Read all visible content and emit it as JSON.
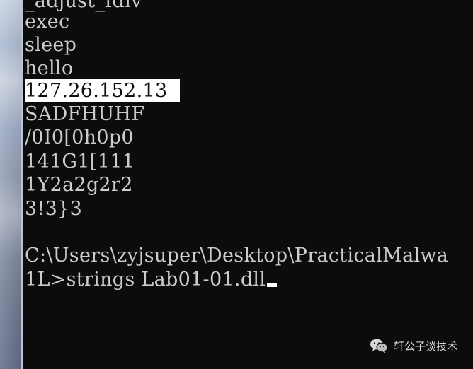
{
  "console": {
    "lines": [
      "_adjust_fdiv",
      "exec",
      "sleep",
      "hello",
      "127.26.152.13",
      "SADFHUHF",
      "/0I0[0h0p0",
      "141G1[111",
      "1Y2a2g2r2",
      "3!3}3",
      "",
      "C:\\Users\\zyjsuper\\Desktop\\PracticalMalwa",
      "1L>strings Lab01-01.dll"
    ],
    "selected_line_index": 4
  },
  "watermark": {
    "text": "轩公子谈技术",
    "icon": "wechat-icon",
    "color": "#d8d8d8"
  },
  "colors": {
    "console_bg": "#0c0c0c",
    "console_text": "#cccccc",
    "selection_bg": "#ffffff",
    "selection_text": "#0c0c0c"
  }
}
